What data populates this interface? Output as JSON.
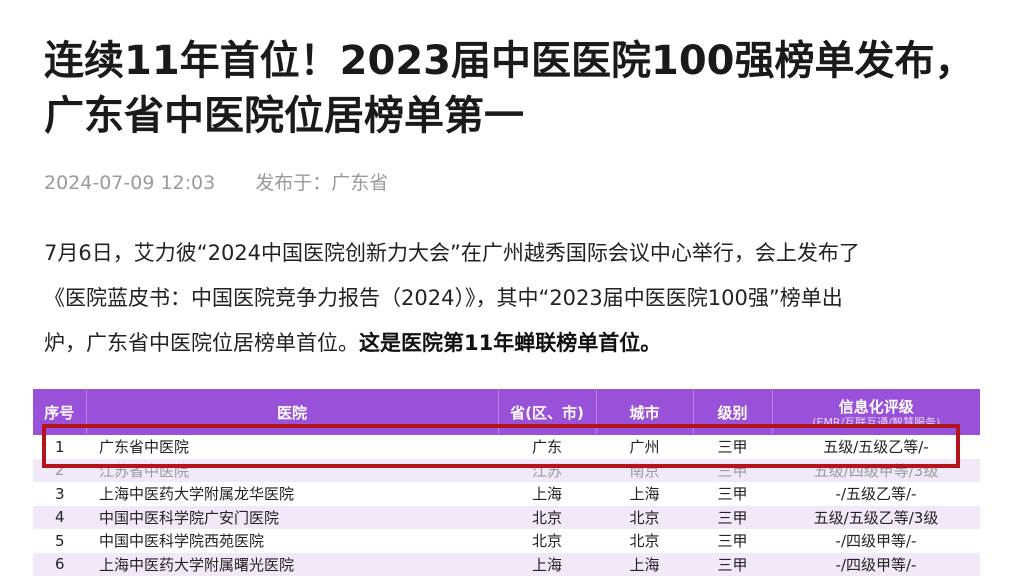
{
  "article": {
    "title_line1": "连续11年首位！2023届中医医院100强榜单发布，",
    "title_line2": "广东省中医院位居榜单第一",
    "date": "2024-07-09 12:03",
    "published_from": "发布于：广东省",
    "paragraph": {
      "line1": "7月6日，艾力彼“2024中国医院创新力大会”在广州越秀国际会议中心举行，会上发布了",
      "line2": "《医院蓝皮书：中国医院竞争力报告（2024）》，其中“2023届中医医院100强”榜单出",
      "line3_normal": "炉，广东省中医院位居榜单首位。",
      "line3_bold": "这是医院第11年蝉联榜单首位。"
    }
  },
  "table": {
    "headers": {
      "no": "序号",
      "hospital": "医院",
      "province": "省(区、市)",
      "city": "城市",
      "level": "级别",
      "info": "信息化评级",
      "info_sub": "(EMR/互联互通/智慧服务)"
    },
    "rows": [
      {
        "no": "1",
        "hospital": "广东省中医院",
        "province": "广东",
        "city": "广州",
        "level": "三甲",
        "rating": "五级/五级乙等/-"
      },
      {
        "no": "2",
        "hospital": "江苏省中医院",
        "province": "江苏",
        "city": "南京",
        "level": "三甲",
        "rating": "五级/四级甲等/3级"
      },
      {
        "no": "3",
        "hospital": "上海中医药大学附属龙华医院",
        "province": "上海",
        "city": "上海",
        "level": "三甲",
        "rating": "-/五级乙等/-"
      },
      {
        "no": "4",
        "hospital": "中国中医科学院广安门医院",
        "province": "北京",
        "city": "北京",
        "level": "三甲",
        "rating": "五级/五级乙等/3级"
      },
      {
        "no": "5",
        "hospital": "中国中医科学院西苑医院",
        "province": "北京",
        "city": "北京",
        "level": "三甲",
        "rating": "-/四级甲等/-"
      },
      {
        "no": "6",
        "hospital": "上海中医药大学附属曙光医院",
        "province": "上海",
        "city": "上海",
        "level": "三甲",
        "rating": "-/四级甲等/-"
      }
    ]
  },
  "colors": {
    "header_bg": "#9a51d9",
    "row_alt_bg": "#f1e9f8",
    "highlight_border": "#b3141b"
  }
}
